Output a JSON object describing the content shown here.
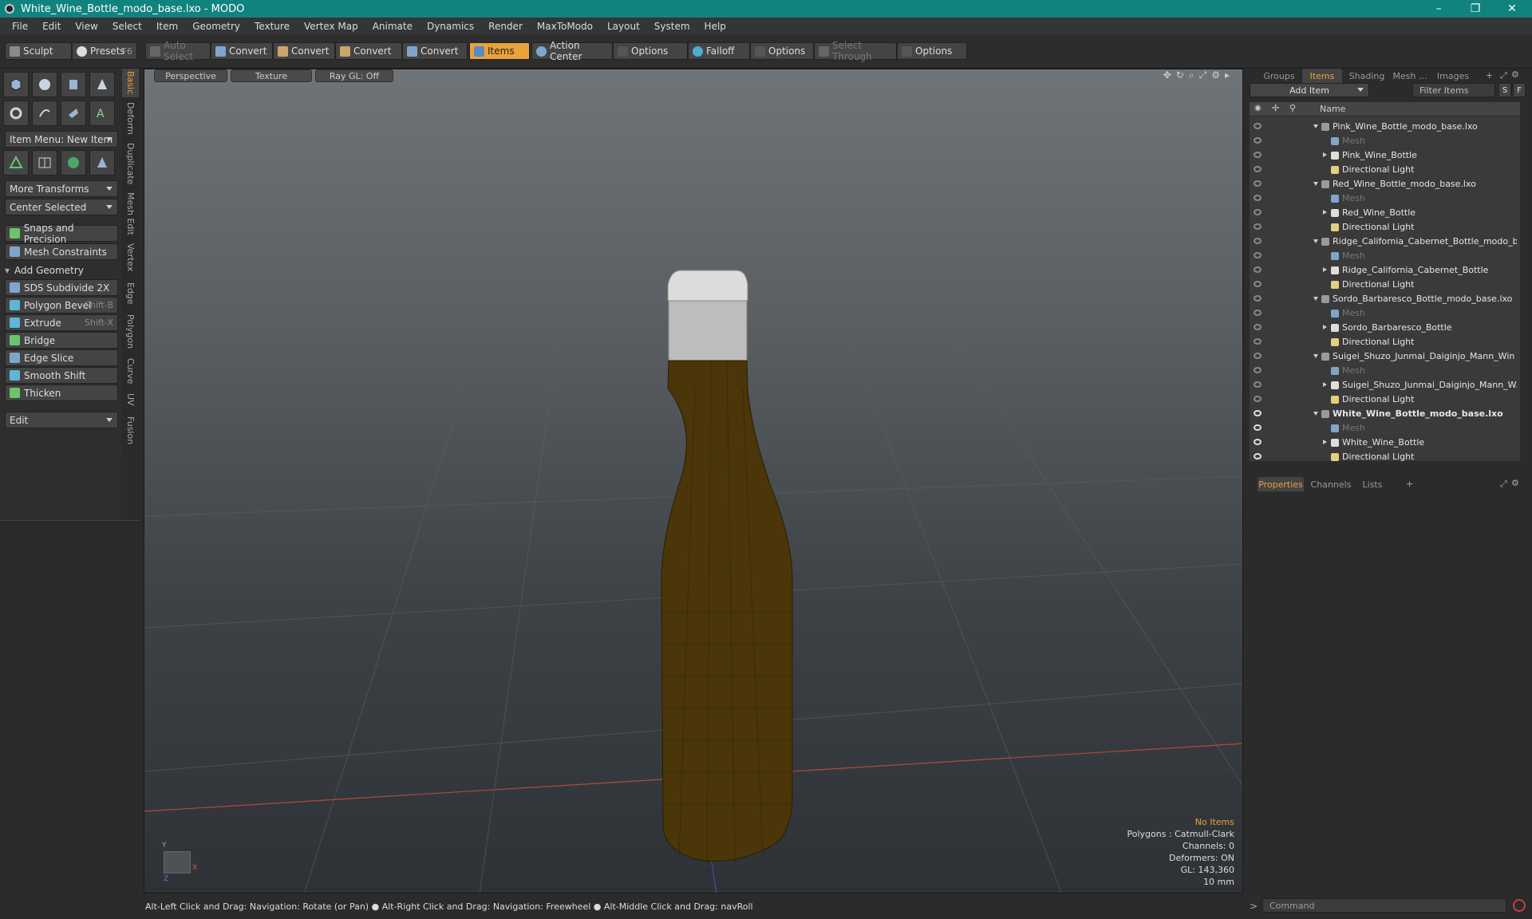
{
  "window": {
    "title": "White_Wine_Bottle_modo_base.lxo - MODO",
    "minimize": "–",
    "maximize": "❐",
    "close": "✕"
  },
  "menu": [
    "File",
    "Edit",
    "View",
    "Select",
    "Item",
    "Geometry",
    "Texture",
    "Vertex Map",
    "Animate",
    "Dynamics",
    "Render",
    "MaxToModo",
    "Layout",
    "System",
    "Help"
  ],
  "toolbar": {
    "sculpt": "Sculpt",
    "presets": "Presets",
    "presets_key": "F6",
    "auto_select": "Auto Select",
    "convert1": "Convert",
    "convert2": "Convert",
    "convert3": "Convert",
    "convert4": "Convert",
    "items": "Items",
    "action_center": "Action Center",
    "options1": "Options",
    "falloff": "Falloff",
    "options2": "Options",
    "select_through": "Select Through",
    "options3": "Options"
  },
  "left_panel": {
    "item_menu": "Item Menu: New Item",
    "more_transforms": "More Transforms",
    "center_selected": "Center Selected",
    "snaps": "Snaps and Precision",
    "mesh_constraints": "Mesh Constraints",
    "add_geometry": "Add Geometry",
    "tools": [
      {
        "label": "SDS Subdivide 2X",
        "key": "",
        "color": "#7fa6c9"
      },
      {
        "label": "Polygon Bevel",
        "key": "Shift-B",
        "color": "#5fb6d6"
      },
      {
        "label": "Extrude",
        "key": "Shift-X",
        "color": "#5fb6d6"
      },
      {
        "label": "Bridge",
        "key": "",
        "color": "#6bc46b"
      },
      {
        "label": "Edge Slice",
        "key": "",
        "color": "#7fa6c9"
      },
      {
        "label": "Smooth Shift",
        "key": "",
        "color": "#5fb6d6"
      },
      {
        "label": "Thicken",
        "key": "",
        "color": "#6bc46b"
      }
    ],
    "edit": "Edit",
    "vtabs": [
      "Basic",
      "Deform",
      "Duplicate",
      "Mesh Edit",
      "Vertex",
      "Edge",
      "Polygon",
      "Curve",
      "UV",
      "Fusion"
    ]
  },
  "viewport": {
    "tab_view": "Perspective",
    "tab_shading": "Texture",
    "tab_raygl": "Ray GL: Off",
    "info": {
      "no_items": "No Items",
      "polygons": "Polygons : Catmull-Clark",
      "channels": "Channels: 0",
      "deformers": "Deformers: ON",
      "gl": "GL: 143,360",
      "unit": "10 mm"
    },
    "axis": {
      "y": "Y",
      "x": "X",
      "z": "Z"
    },
    "colors": {
      "bottle": "#4a3608",
      "cap": "#b8b8b8"
    }
  },
  "status": "Alt-Left Click and Drag: Navigation: Rotate (or Pan) ● Alt-Right Click and Drag: Navigation: Freewheel ● Alt-Middle Click and Drag: navRoll",
  "right_panel": {
    "tabs": [
      "Groups",
      "Items",
      "Shading",
      "Mesh ...",
      "Images"
    ],
    "add_item": "Add Item",
    "filter_items": "Filter Items",
    "btn_s": "S",
    "btn_f": "F",
    "col_name": "Name",
    "tree": [
      {
        "label": "Pink_Wine_Bottle_modo_base.lxo",
        "level": 0,
        "kind": "scene"
      },
      {
        "label": "Mesh",
        "level": 1,
        "kind": "mesh"
      },
      {
        "label": "Pink_Wine_Bottle",
        "level": 1,
        "kind": "item"
      },
      {
        "label": "Directional Light",
        "level": 1,
        "kind": "light"
      },
      {
        "label": "Red_Wine_Bottle_modo_base.lxo",
        "level": 0,
        "kind": "scene"
      },
      {
        "label": "Mesh",
        "level": 1,
        "kind": "mesh"
      },
      {
        "label": "Red_Wine_Bottle",
        "level": 1,
        "kind": "item"
      },
      {
        "label": "Directional Light",
        "level": 1,
        "kind": "light"
      },
      {
        "label": "Ridge_California_Cabernet_Bottle_modo_b...",
        "level": 0,
        "kind": "scene"
      },
      {
        "label": "Mesh",
        "level": 1,
        "kind": "mesh"
      },
      {
        "label": "Ridge_California_Cabernet_Bottle",
        "level": 1,
        "kind": "item"
      },
      {
        "label": "Directional Light",
        "level": 1,
        "kind": "light"
      },
      {
        "label": "Sordo_Barbaresco_Bottle_modo_base.lxo",
        "level": 0,
        "kind": "scene"
      },
      {
        "label": "Mesh",
        "level": 1,
        "kind": "mesh"
      },
      {
        "label": "Sordo_Barbaresco_Bottle",
        "level": 1,
        "kind": "item"
      },
      {
        "label": "Directional Light",
        "level": 1,
        "kind": "light"
      },
      {
        "label": "Suigei_Shuzo_Junmai_Daiginjo_Mann_Win ...",
        "level": 0,
        "kind": "scene"
      },
      {
        "label": "Mesh",
        "level": 1,
        "kind": "mesh"
      },
      {
        "label": "Suigei_Shuzo_Junmai_Daiginjo_Mann_W...",
        "level": 1,
        "kind": "item"
      },
      {
        "label": "Directional Light",
        "level": 1,
        "kind": "light"
      },
      {
        "label": "White_Wine_Bottle_modo_base.lxo",
        "level": 0,
        "kind": "scene",
        "bold": true
      },
      {
        "label": "Mesh",
        "level": 1,
        "kind": "mesh"
      },
      {
        "label": "White_Wine_Bottle",
        "level": 1,
        "kind": "item"
      },
      {
        "label": "Directional Light",
        "level": 1,
        "kind": "light"
      }
    ],
    "bottom_tabs": [
      "Properties",
      "Channels",
      "Lists"
    ],
    "command_placeholder": "Command"
  }
}
